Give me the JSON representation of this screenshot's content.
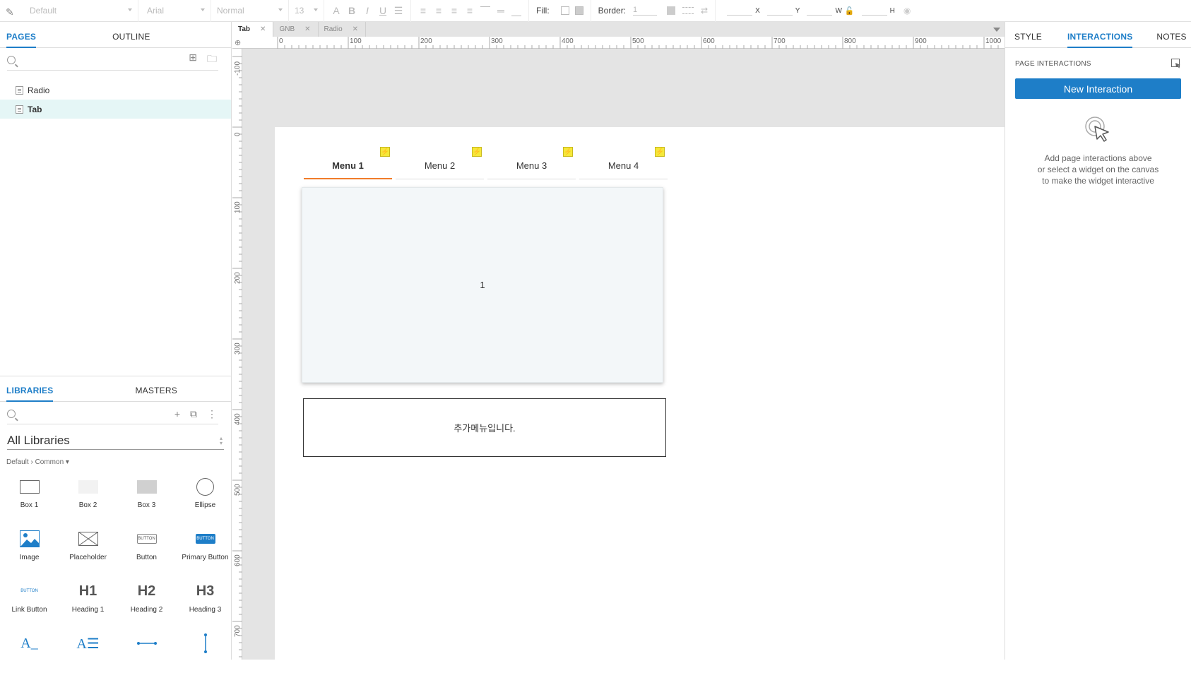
{
  "toolbar": {
    "style_select": "Default",
    "font_select": "Arial",
    "weight_select": "Normal",
    "size_select": "13",
    "fill_label": "Fill:",
    "border_label": "Border:",
    "border_value": "1",
    "x_label": "X",
    "y_label": "Y",
    "w_label": "W",
    "h_label": "H"
  },
  "left_panel": {
    "tabs": [
      "PAGES",
      "OUTLINE"
    ],
    "pages": [
      "Radio",
      "Tab"
    ],
    "lib_tabs": [
      "LIBRARIES",
      "MASTERS"
    ],
    "library_select": "All Libraries",
    "breadcrumb": "Default › Common ▾",
    "widgets": [
      "Box 1",
      "Box 2",
      "Box 3",
      "Ellipse",
      "Image",
      "Placeholder",
      "Button",
      "Primary Button",
      "Link Button",
      "Heading 1",
      "Heading 2",
      "Heading 3"
    ],
    "button_thumb": "BUTTON",
    "primary_thumb": "BUTTON",
    "link_thumb": "BUTTON",
    "h1_thumb": "H1",
    "h2_thumb": "H2",
    "h3_thumb": "H3"
  },
  "doc_tabs": [
    "Tab",
    "GNB",
    "Radio"
  ],
  "ruler_h": [
    "0",
    "100",
    "200",
    "300",
    "400",
    "500",
    "600",
    "700",
    "800",
    "900",
    "1000"
  ],
  "ruler_v": [
    "-100",
    "0",
    "100",
    "200",
    "300",
    "400",
    "500",
    "600",
    "700"
  ],
  "canvas": {
    "menus": [
      "Menu 1",
      "Menu 2",
      "Menu 3",
      "Menu 4"
    ],
    "panel_text": "1",
    "extra_text": "추가메뉴입니다."
  },
  "right_panel": {
    "tabs": [
      "STYLE",
      "INTERACTIONS",
      "NOTES"
    ],
    "section_title": "PAGE INTERACTIONS",
    "new_button": "New Interaction",
    "hint_1": "Add page interactions above",
    "hint_2": "or select a widget on the canvas",
    "hint_3": "to make the widget interactive"
  },
  "colors": {
    "accent": "#1e7ec8",
    "tab_underline": "#f07c2a",
    "interaction_badge": "#f5e83a",
    "selected_page": "#e5f6f6"
  }
}
